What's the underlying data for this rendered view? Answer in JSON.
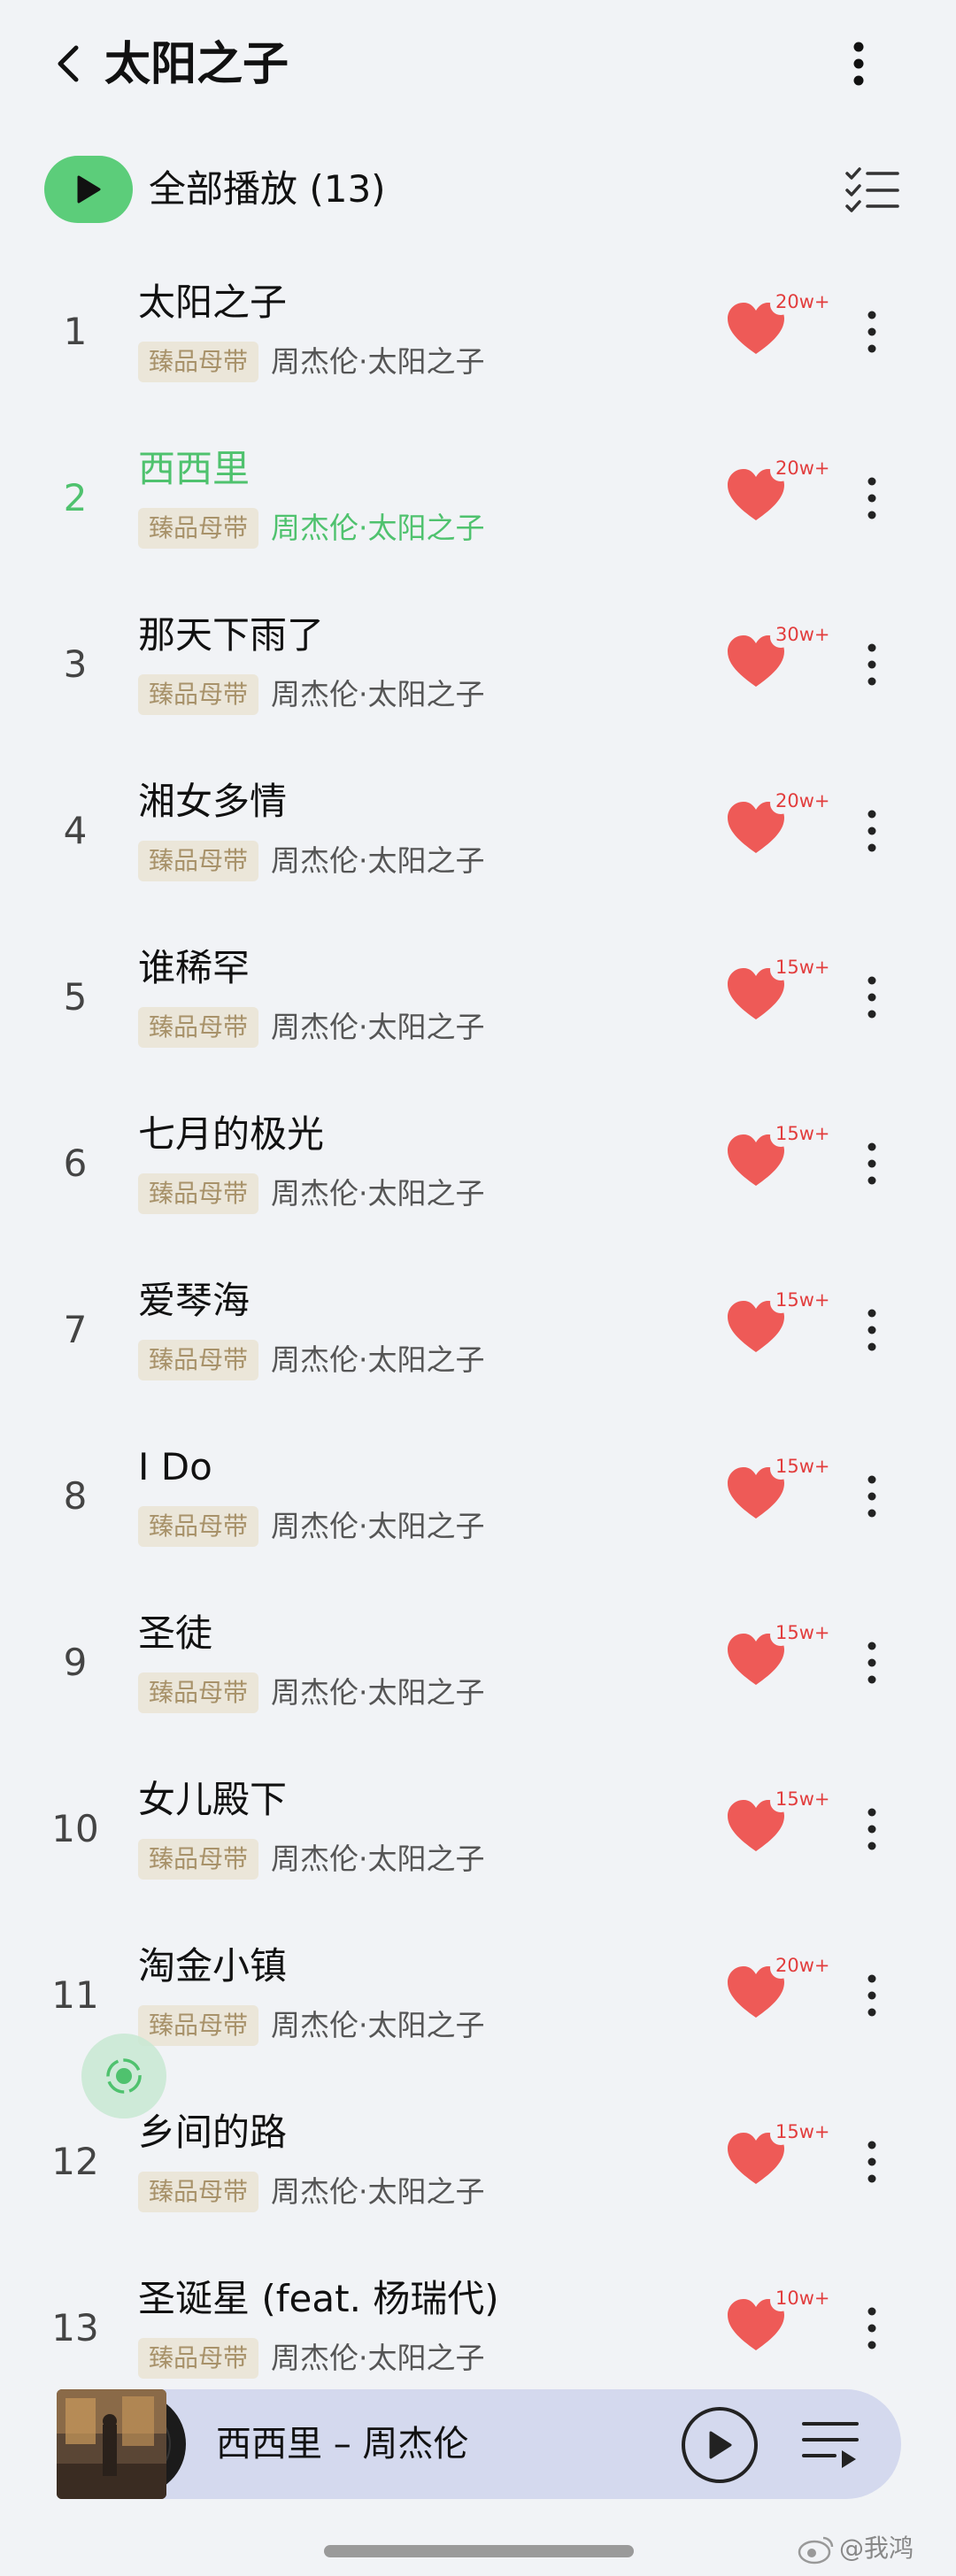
{
  "header": {
    "title": "太阳之子"
  },
  "playall": {
    "label": "全部播放 (13)"
  },
  "songs": [
    {
      "index": "1",
      "title": "太阳之子",
      "tag": "臻品母带",
      "meta": "周杰伦·太阳之子",
      "likes": "20w+",
      "active": false
    },
    {
      "index": "2",
      "title": "西西里",
      "tag": "臻品母带",
      "meta": "周杰伦·太阳之子",
      "likes": "20w+",
      "active": true
    },
    {
      "index": "3",
      "title": "那天下雨了",
      "tag": "臻品母带",
      "meta": "周杰伦·太阳之子",
      "likes": "30w+",
      "active": false
    },
    {
      "index": "4",
      "title": "湘女多情",
      "tag": "臻品母带",
      "meta": "周杰伦·太阳之子",
      "likes": "20w+",
      "active": false
    },
    {
      "index": "5",
      "title": "谁稀罕",
      "tag": "臻品母带",
      "meta": "周杰伦·太阳之子",
      "likes": "15w+",
      "active": false
    },
    {
      "index": "6",
      "title": "七月的极光",
      "tag": "臻品母带",
      "meta": "周杰伦·太阳之子",
      "likes": "15w+",
      "active": false
    },
    {
      "index": "7",
      "title": "爱琴海",
      "tag": "臻品母带",
      "meta": "周杰伦·太阳之子",
      "likes": "15w+",
      "active": false
    },
    {
      "index": "8",
      "title": "I Do",
      "tag": "臻品母带",
      "meta": "周杰伦·太阳之子",
      "likes": "15w+",
      "active": false
    },
    {
      "index": "9",
      "title": "圣徒",
      "tag": "臻品母带",
      "meta": "周杰伦·太阳之子",
      "likes": "15w+",
      "active": false
    },
    {
      "index": "10",
      "title": "女儿殿下",
      "tag": "臻品母带",
      "meta": "周杰伦·太阳之子",
      "likes": "15w+",
      "active": false
    },
    {
      "index": "11",
      "title": "淘金小镇",
      "tag": "臻品母带",
      "meta": "周杰伦·太阳之子",
      "likes": "20w+",
      "active": false
    },
    {
      "index": "12",
      "title": "乡间的路",
      "tag": "臻品母带",
      "meta": "周杰伦·太阳之子",
      "likes": "15w+",
      "active": false
    },
    {
      "index": "13",
      "title": "圣诞星 (feat. 杨瑞代)",
      "tag": "臻品母带",
      "meta": "周杰伦·太阳之子",
      "likes": "10w+",
      "active": false
    }
  ],
  "player": {
    "now_playing": "西西里 – 周杰伦"
  },
  "watermark": {
    "text": "@我鸿"
  },
  "colors": {
    "background": "#f1f3f6",
    "accent_green": "#5ccd7a",
    "active_text": "#4fc26e",
    "heart_red": "#ee5a57",
    "tag_bg": "#ebe6d9",
    "tag_text": "#a8926a",
    "player_bg": "#d4d9ee"
  },
  "icons": {
    "back": "chevron-left-icon",
    "more": "more-vertical-icon",
    "play": "play-icon",
    "multiselect": "checklist-icon",
    "heart": "heart-icon",
    "locate": "locate-icon",
    "playlist": "playlist-icon"
  }
}
